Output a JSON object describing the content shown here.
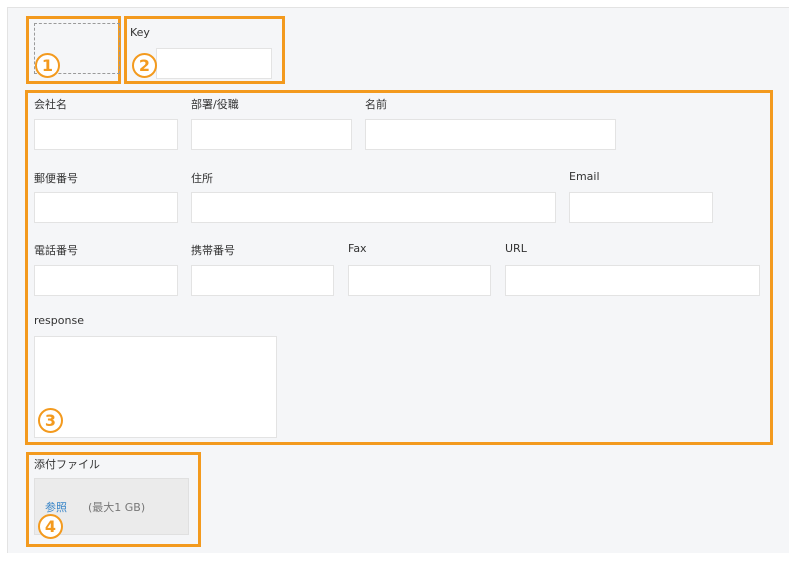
{
  "badges": [
    "1",
    "2",
    "3",
    "4"
  ],
  "key_section": {
    "label": "Key",
    "value": ""
  },
  "fields": {
    "company": {
      "label": "会社名",
      "value": ""
    },
    "department": {
      "label": "部署/役職",
      "value": ""
    },
    "name": {
      "label": "名前",
      "value": ""
    },
    "postal": {
      "label": "郵便番号",
      "value": ""
    },
    "address": {
      "label": "住所",
      "value": ""
    },
    "email": {
      "label": "Email",
      "value": ""
    },
    "phone": {
      "label": "電話番号",
      "value": ""
    },
    "mobile": {
      "label": "携帯番号",
      "value": ""
    },
    "fax": {
      "label": "Fax",
      "value": ""
    },
    "url": {
      "label": "URL",
      "value": ""
    },
    "response": {
      "label": "response",
      "value": ""
    }
  },
  "attachment": {
    "label": "添付ファイル",
    "browse_label": "参照",
    "max_size_label": "(最大1 GB)"
  },
  "colors": {
    "highlight": "#f39a1e",
    "link": "#3a86c8",
    "background": "#f5f6f8"
  }
}
